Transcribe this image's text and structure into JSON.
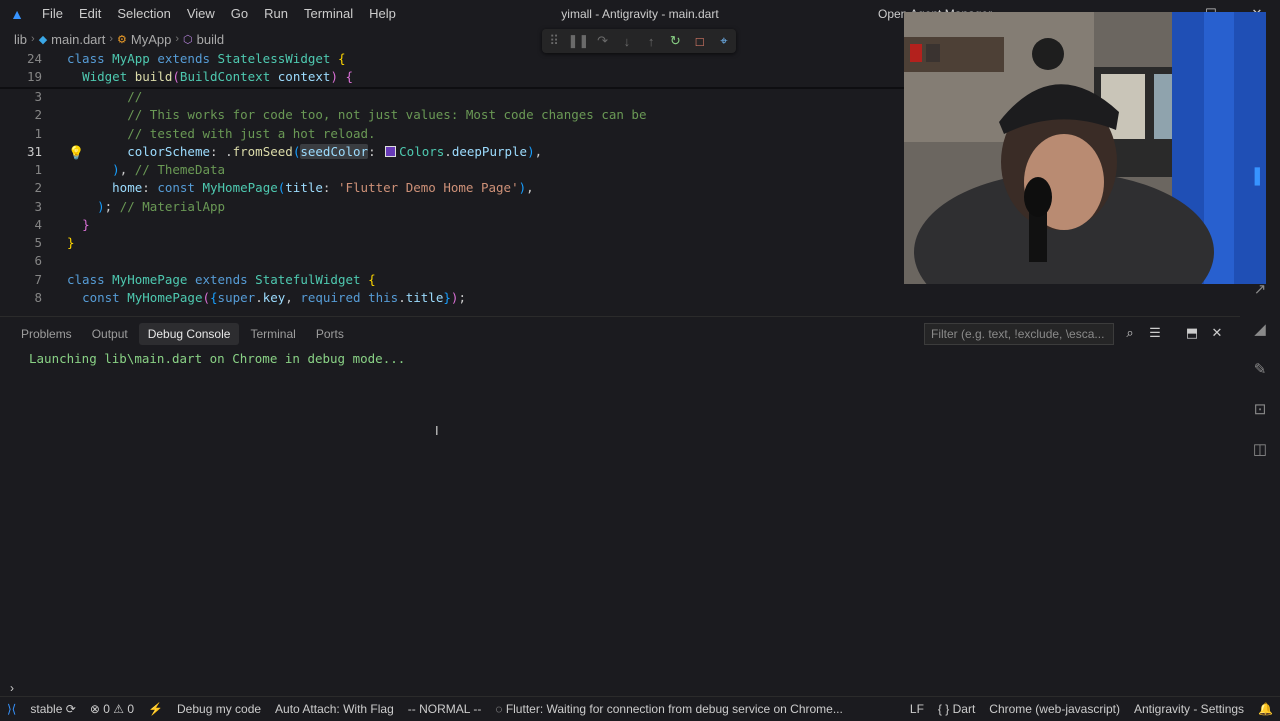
{
  "titlebar": {
    "menu": [
      "File",
      "Edit",
      "Selection",
      "View",
      "Go",
      "Run",
      "Terminal",
      "Help"
    ],
    "window_title": "yimall - Antigravity - main.dart",
    "open_agent_manager": "Open Agent Manager"
  },
  "breadcrumb": {
    "items": [
      "lib",
      "main.dart",
      "MyApp",
      "build"
    ]
  },
  "editor": {
    "sticky": [
      {
        "ln": "24",
        "segments": [
          [
            "kw",
            "class "
          ],
          [
            "cls",
            "MyApp "
          ],
          [
            "kw",
            "extends "
          ],
          [
            "cls",
            "StatelessWidget "
          ],
          [
            "br1",
            "{"
          ]
        ]
      },
      {
        "ln": "19",
        "segments": [
          [
            "pun",
            "  "
          ],
          [
            "cls",
            "Widget "
          ],
          [
            "fn",
            "build"
          ],
          [
            "br2",
            "("
          ],
          [
            "cls",
            "BuildContext "
          ],
          [
            "var",
            "context"
          ],
          [
            "br2",
            ") "
          ],
          [
            "br2",
            "{"
          ]
        ]
      }
    ],
    "lines": [
      {
        "ln": "3",
        "active": false,
        "segments": [
          [
            "pun",
            "        "
          ],
          [
            "cmt",
            "//"
          ]
        ]
      },
      {
        "ln": "2",
        "active": false,
        "segments": [
          [
            "pun",
            "        "
          ],
          [
            "cmt",
            "// This works for code too, not just values: Most code changes can be"
          ]
        ]
      },
      {
        "ln": "1",
        "active": false,
        "segments": [
          [
            "pun",
            "        "
          ],
          [
            "cmt",
            "// tested with just a hot reload."
          ]
        ]
      },
      {
        "ln": "31",
        "active": true,
        "segments": [
          [
            "pun",
            "        "
          ],
          [
            "var",
            "colorScheme"
          ],
          [
            "pun",
            ": ."
          ],
          [
            "fn",
            "fromSeed"
          ],
          [
            "br3",
            "("
          ],
          [
            "hlvar",
            "seedColor"
          ],
          [
            "pun",
            ": "
          ],
          [
            "swatch",
            ""
          ],
          [
            "cls",
            "Colors"
          ],
          [
            "pun",
            "."
          ],
          [
            "var",
            "deepPurple"
          ],
          [
            "br3",
            ")"
          ],
          [
            "pun",
            ","
          ]
        ]
      },
      {
        "ln": "1",
        "active": false,
        "segments": [
          [
            "pun",
            "      "
          ],
          [
            "br3",
            ")"
          ],
          [
            "pun",
            ", "
          ],
          [
            "cmt",
            "// ThemeData"
          ]
        ]
      },
      {
        "ln": "2",
        "active": false,
        "segments": [
          [
            "pun",
            "      "
          ],
          [
            "var",
            "home"
          ],
          [
            "pun",
            ": "
          ],
          [
            "kw",
            "const "
          ],
          [
            "cls",
            "MyHomePage"
          ],
          [
            "br3",
            "("
          ],
          [
            "var",
            "title"
          ],
          [
            "pun",
            ": "
          ],
          [
            "str",
            "'Flutter Demo Home Page'"
          ],
          [
            "br3",
            ")"
          ],
          [
            "pun",
            ","
          ]
        ]
      },
      {
        "ln": "3",
        "active": false,
        "segments": [
          [
            "pun",
            "    "
          ],
          [
            "br3",
            ")"
          ],
          [
            "pun",
            "; "
          ],
          [
            "cmt",
            "// MaterialApp"
          ]
        ]
      },
      {
        "ln": "4",
        "active": false,
        "segments": [
          [
            "pun",
            "  "
          ],
          [
            "br2",
            "}"
          ]
        ]
      },
      {
        "ln": "5",
        "active": false,
        "segments": [
          [
            "br1",
            "}"
          ]
        ]
      },
      {
        "ln": "6",
        "active": false,
        "segments": []
      },
      {
        "ln": "7",
        "active": false,
        "segments": [
          [
            "kw",
            "class "
          ],
          [
            "cls",
            "MyHomePage "
          ],
          [
            "kw",
            "extends "
          ],
          [
            "cls",
            "StatefulWidget "
          ],
          [
            "br1",
            "{"
          ]
        ]
      },
      {
        "ln": "8",
        "active": false,
        "segments": [
          [
            "pun",
            "  "
          ],
          [
            "kw",
            "const "
          ],
          [
            "cls",
            "MyHomePage"
          ],
          [
            "br2",
            "("
          ],
          [
            "br3",
            "{"
          ],
          [
            "kw",
            "super"
          ],
          [
            "pun",
            "."
          ],
          [
            "var",
            "key"
          ],
          [
            "pun",
            ", "
          ],
          [
            "kw",
            "required "
          ],
          [
            "kw",
            "this"
          ],
          [
            "pun",
            "."
          ],
          [
            "var",
            "title"
          ],
          [
            "br3",
            "}"
          ],
          [
            "br2",
            ")"
          ],
          [
            "pun",
            ";"
          ]
        ]
      }
    ]
  },
  "panel": {
    "tabs": [
      "Problems",
      "Output",
      "Debug Console",
      "Terminal",
      "Ports"
    ],
    "active_tab": "Debug Console",
    "filter_placeholder": "Filter (e.g. text, !exclude, \\esca...",
    "output": "Launching lib\\main.dart on Chrome in debug mode..."
  },
  "statusbar": {
    "branch": "stable",
    "errors": "0",
    "warnings": "0",
    "debug_my_code": "Debug my code",
    "auto_attach": "Auto Attach: With Flag",
    "vim_mode": "-- NORMAL --",
    "flutter_status": "Flutter: Waiting for connection from debug service on Chrome...",
    "eol": "LF",
    "language": "Dart",
    "device": "Chrome (web-javascript)",
    "settings": "Antigravity - Settings"
  },
  "colors": {
    "background": "#1b1b1f",
    "accent": "#3794ff",
    "console_text": "#89d185",
    "swatch": "#673ab7"
  }
}
